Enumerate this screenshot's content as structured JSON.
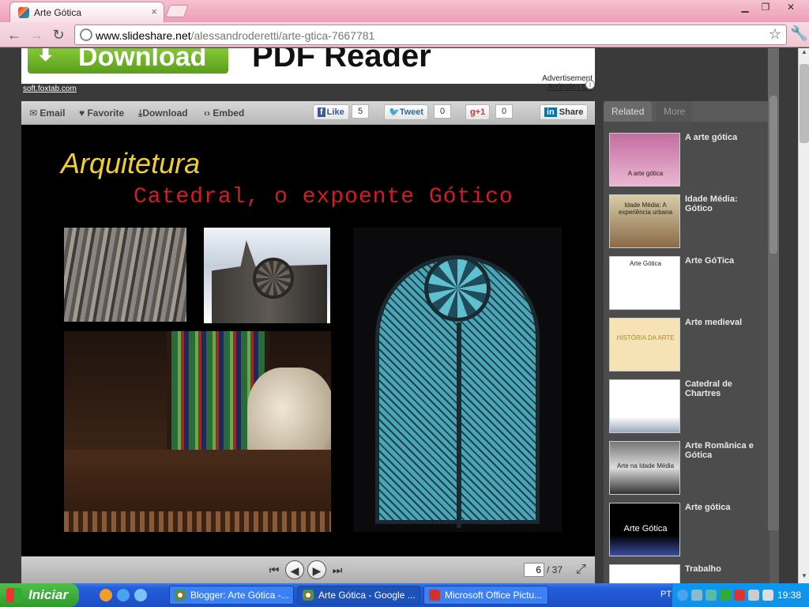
{
  "browser": {
    "tab_title": "Arte Gótica",
    "url_host": "www.slideshare.net",
    "url_path": "/alessandroderetti/arte-gtica-7667781",
    "window_buttons": [
      "▁",
      "❐",
      "✕"
    ]
  },
  "ad": {
    "download_label": "Download",
    "headline": "PDF Reader",
    "link": "soft.foxtab.com",
    "advertisement_label": "Advertisement",
    "anuncios_label": "Anúncios Go"
  },
  "slide_toolbar": {
    "email": "Email",
    "favorite": "Favorite",
    "download": "Download",
    "embed": "Embed",
    "like": "Like",
    "like_count": "5",
    "tweet": "Tweet",
    "tweet_count": "0",
    "plus": "+1",
    "plus_count": "0",
    "share": "Share"
  },
  "slide": {
    "title": "Arquitetura",
    "subtitle": "Catedral, o expoente Gótico"
  },
  "pager": {
    "current": "6",
    "total": "/ 37"
  },
  "related": {
    "tabs": [
      "Related",
      "More"
    ],
    "items": [
      {
        "title": "A arte gótica",
        "thumb_text": "A arte gótica"
      },
      {
        "title": "Idade Média: Gótico",
        "thumb_text": "Idade Média: A experiência urbana"
      },
      {
        "title": "Arte GóTica",
        "thumb_text": "Arte Gótica"
      },
      {
        "title": "Arte medieval",
        "thumb_text": "HISTÓRIA DA ARTE"
      },
      {
        "title": "Catedral de Chartres",
        "thumb_text": ""
      },
      {
        "title": "Arte Românica e Gótica",
        "thumb_text": "Arte na Idade Média"
      },
      {
        "title": "Arte gótica",
        "thumb_text": "Arte Gótica"
      },
      {
        "title": "Trabalho",
        "thumb_text": ""
      }
    ]
  },
  "taskbar": {
    "start": "Iniciar",
    "tasks": [
      {
        "label": "Blogger: Arte Gótica -...",
        "active": false
      },
      {
        "label": "Arte Gótica - Google ...",
        "active": true
      },
      {
        "label": "Microsoft Office Pictu...",
        "active": false
      }
    ],
    "lang": "PT",
    "clock": "19:38"
  },
  "colors": {
    "title_yellow": "#f0d02a",
    "subtitle_red": "#d41c22",
    "chrome_pink": "#f6c1d0"
  }
}
